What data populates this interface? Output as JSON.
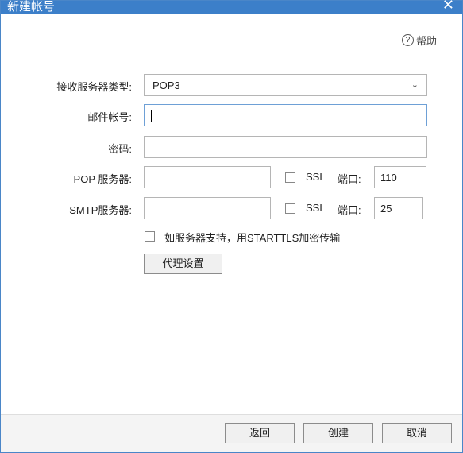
{
  "window": {
    "title": "新建帐号",
    "close_label": "✕"
  },
  "help": {
    "icon_text": "?",
    "label": "帮助"
  },
  "form": {
    "server_type_label": "接收服务器类型:",
    "server_type_value": "POP3",
    "account_label": "邮件帐号:",
    "account_value": "",
    "password_label": "密码:",
    "password_value": "",
    "pop_server_label": "POP 服务器:",
    "pop_server_value": "",
    "pop_ssl_label": "SSL",
    "pop_port_label": "端口:",
    "pop_port_value": "110",
    "smtp_server_label": "SMTP服务器:",
    "smtp_server_value": "",
    "smtp_ssl_label": "SSL",
    "smtp_port_label": "端口:",
    "smtp_port_value": "25",
    "starttls_label": "如服务器支持，用STARTTLS加密传输",
    "proxy_button": "代理设置"
  },
  "footer": {
    "back": "返回",
    "create": "创建",
    "cancel": "取消"
  },
  "colors": {
    "titlebar": "#3c7fc9",
    "focus_border": "#6ea0d6"
  }
}
